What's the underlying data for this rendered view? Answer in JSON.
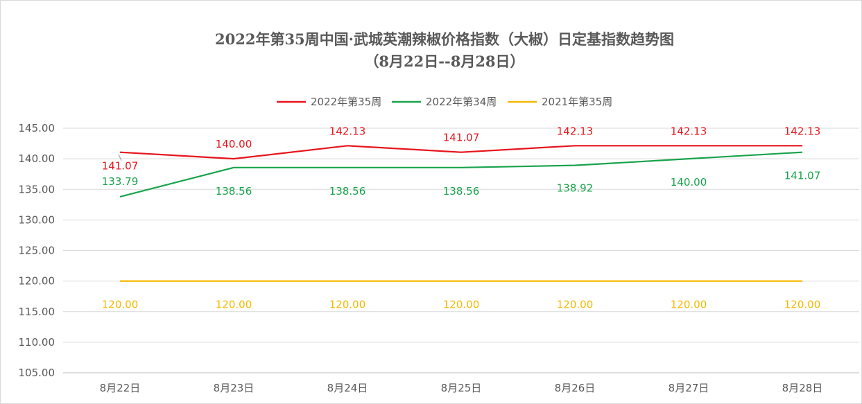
{
  "chart_data": {
    "type": "line",
    "title": "2022年第35周中国·武城英潮辣椒价格指数（大椒）日定基指数趋势图",
    "subtitle": "（8月22日--8月28日）",
    "categories": [
      "8月22日",
      "8月23日",
      "8月24日",
      "8月25日",
      "8月26日",
      "8月27日",
      "8月28日"
    ],
    "ylim": [
      105,
      145
    ],
    "yticks": [
      "105.00",
      "110.00",
      "115.00",
      "120.00",
      "125.00",
      "130.00",
      "135.00",
      "140.00",
      "145.00"
    ],
    "grid": true,
    "legend_position": "top",
    "series": [
      {
        "name": "2022年第35周",
        "color": "#e8141b",
        "values": [
          141.07,
          140.0,
          142.13,
          141.07,
          142.13,
          142.13,
          142.13
        ],
        "labels": [
          "141.07",
          "140.00",
          "142.13",
          "141.07",
          "142.13",
          "142.13",
          "142.13"
        ]
      },
      {
        "name": "2022年第34周",
        "color": "#17a34a",
        "values": [
          133.79,
          138.56,
          138.56,
          138.56,
          138.92,
          140.0,
          141.07
        ],
        "labels": [
          "133.79",
          "138.56",
          "138.56",
          "138.56",
          "138.92",
          "140.00",
          "141.07"
        ]
      },
      {
        "name": "2021年第35周",
        "color": "#f5b800",
        "values": [
          120.0,
          120.0,
          120.0,
          120.0,
          120.0,
          120.0,
          120.0
        ],
        "labels": [
          "120.00",
          "120.00",
          "120.00",
          "120.00",
          "120.00",
          "120.00",
          "120.00"
        ]
      }
    ]
  }
}
